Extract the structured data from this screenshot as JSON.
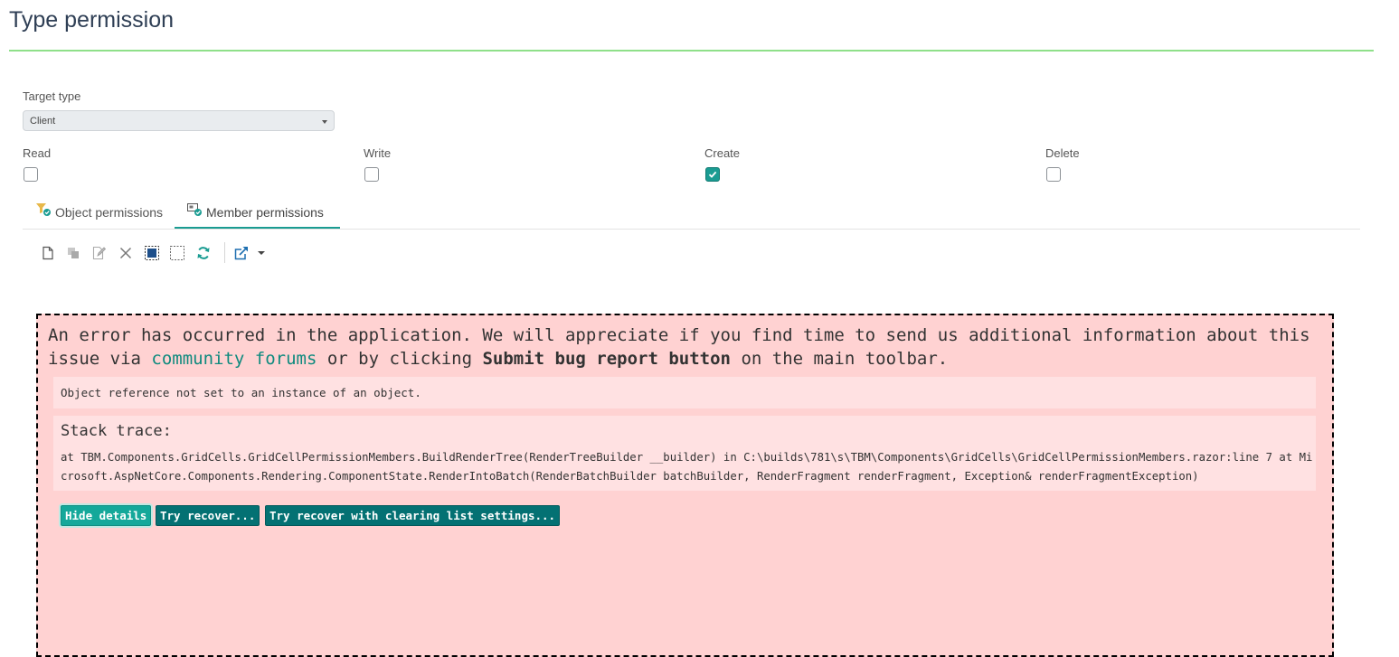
{
  "page": {
    "title": "Type permission"
  },
  "form": {
    "target_type": {
      "label": "Target type",
      "value": "Client"
    },
    "permissions": [
      {
        "label": "Read",
        "checked": false
      },
      {
        "label": "Write",
        "checked": false
      },
      {
        "label": "Create",
        "checked": true
      },
      {
        "label": "Delete",
        "checked": false
      }
    ]
  },
  "tabs": [
    {
      "label": "Object permissions",
      "active": false,
      "icon": "object-permissions-icon"
    },
    {
      "label": "Member permissions",
      "active": true,
      "icon": "member-permissions-icon"
    }
  ],
  "toolbar": {
    "icons": [
      "new-icon",
      "copy-icon",
      "edit-icon",
      "delete-icon",
      "select-all-icon",
      "unselect-all-icon",
      "refresh-icon",
      "export-icon",
      "dropdown-caret-icon"
    ]
  },
  "error": {
    "message_part1": "An error has occurred in the application. We will appreciate if you find time to send us additional information about this issue via ",
    "link_text": "community forums",
    "message_part2": " or by clicking ",
    "bold_text": "Submit bug report button",
    "message_part3": " on the main toolbar.",
    "exception": "Object reference not set to an instance of an object.",
    "stack_title": "Stack trace:",
    "stack_trace": "at TBM.Components.GridCells.GridCellPermissionMembers.BuildRenderTree(RenderTreeBuilder __builder) in C:\\builds\\781\\s\\TBM\\Components\\GridCells\\GridCellPermissionMembers.razor:line 7 at Microsoft.AspNetCore.Components.Rendering.ComponentState.RenderIntoBatch(RenderBatchBuilder batchBuilder, RenderFragment renderFragment, Exception& renderFragmentException)",
    "buttons": {
      "hide_details": "Hide details",
      "try_recover": "Try recover...",
      "try_recover_clear": "Try recover with clearing list settings..."
    }
  },
  "colors": {
    "accent": "#1a9c92",
    "title_rule": "#8fe08a",
    "error_bg": "#ffd2d2",
    "error_detail_bg": "#ffe1e2",
    "button_dark": "#047173",
    "link": "#0e8a7e"
  }
}
